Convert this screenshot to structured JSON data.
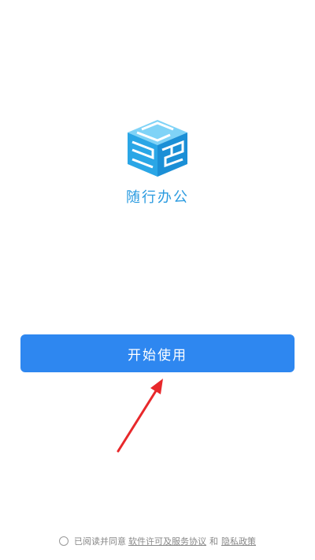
{
  "app": {
    "name": "随行办公",
    "logo_icon": "cube-logo-icon",
    "brand_color": "#2b9be0"
  },
  "start_button": {
    "label": "开始使用",
    "color": "#2e87f0"
  },
  "annotation": {
    "icon": "red-arrow-icon",
    "color": "#e8282b"
  },
  "agreement": {
    "prefix": "已阅读并同意",
    "license_link": "软件许可及服务协议",
    "conjunction": "和",
    "privacy_link": "隐私政策",
    "checked": false
  }
}
